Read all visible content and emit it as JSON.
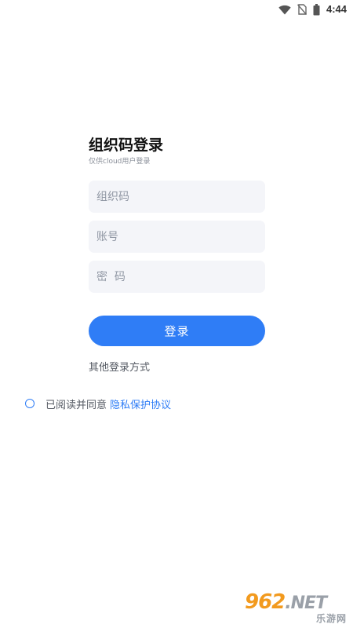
{
  "status_bar": {
    "time": "4:44",
    "icons": [
      "wifi-icon",
      "no-sim-icon",
      "battery-icon"
    ]
  },
  "login": {
    "title": "组织码登录",
    "subtitle": "仅供cloud用户登录",
    "org_code_placeholder": "组织码",
    "account_placeholder": "账号",
    "password_placeholder": "密  码",
    "submit_label": "登录",
    "other_login_label": "其他登录方式"
  },
  "agreement": {
    "text": "已阅读并同意",
    "link_label": "隐私保护协议"
  },
  "watermark": {
    "main_number": "962",
    "main_suffix": ".NET",
    "sub": "乐游网"
  },
  "colors": {
    "accent": "#2f7df6",
    "field_bg": "#f4f5f9",
    "watermark_orange": "#f29a1e"
  }
}
